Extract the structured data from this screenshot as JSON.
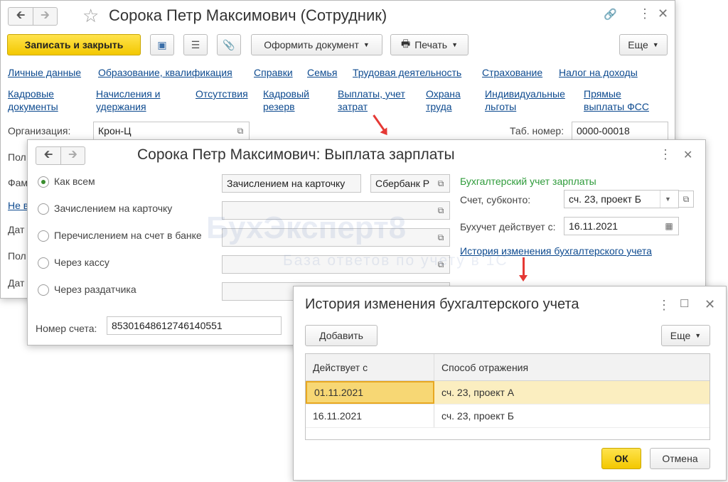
{
  "employee_window": {
    "title": "Сорока Петр Максимович (Сотрудник)",
    "toolbar": {
      "save_close": "Записать и закрыть",
      "create_doc": "Оформить документ",
      "print": "Печать",
      "more": "Еще"
    },
    "nav_links_row1": [
      "Личные данные",
      "Образование, квалификация",
      "Справки",
      "Семья",
      "Трудовая деятельность",
      "Страхование",
      "Налог на доходы"
    ],
    "nav_links_row2": [
      {
        "l1": "Кадровые",
        "l2": "документы"
      },
      {
        "l1": "Начисления и",
        "l2": "удержания"
      },
      {
        "l1": "Отсутствия",
        "l2": ""
      },
      {
        "l1": "Кадровый",
        "l2": "резерв"
      },
      {
        "l1": "Выплаты, учет",
        "l2": "затрат"
      },
      {
        "l1": "Охрана",
        "l2": "труда"
      },
      {
        "l1": "Индивидуальные",
        "l2": "льготы"
      },
      {
        "l1": "Прямые",
        "l2": "выплаты ФСС"
      }
    ],
    "org_label": "Организация:",
    "org_value": "Крон-Ц",
    "tab_num_label": "Таб. номер:",
    "tab_num_value": "0000-00018",
    "partial_labels": [
      "Пол",
      "Фам",
      "Не в",
      "Дат",
      "Пол",
      "Дат"
    ]
  },
  "payment_window": {
    "title": "Сорока Петр Максимович: Выплата зарплаты",
    "options": [
      "Как всем",
      "Зачислением на карточку",
      "Перечислением на счет в банке",
      "Через кассу",
      "Через раздатчика"
    ],
    "method_value": "Зачислением на карточку",
    "bank_value": "Сбербанк Р",
    "account_label": "Номер счета:",
    "account_value": "85301648612746140551",
    "acc_section_title": "Бухгалтерский учет зарплаты",
    "account_subconto_label": "Счет, субконто:",
    "account_subconto_value": "сч. 23, проект Б",
    "valid_from_label": "Бухучет действует с:",
    "valid_from_value": "16.11.2021",
    "history_link": "История изменения бухгалтерского учета"
  },
  "history_window": {
    "title": "История изменения бухгалтерского учета",
    "add_button": "Добавить",
    "more_button": "Еще",
    "columns": [
      "Действует с",
      "Способ отражения"
    ],
    "rows": [
      {
        "date": "01.11.2021",
        "method": "сч. 23, проект А"
      },
      {
        "date": "16.11.2021",
        "method": "сч. 23, проект Б"
      }
    ],
    "ok": "ОК",
    "cancel": "Отмена"
  },
  "watermark": {
    "brand": "БухЭксперт8",
    "tagline": "База ответов по учету в 1С"
  },
  "colors": {
    "accent_yellow": "#f3c800",
    "link_blue": "#0d4a8f",
    "section_green": "#2e9b3a",
    "arrow_red": "#e53935",
    "selected_row": "#fbeec0"
  }
}
